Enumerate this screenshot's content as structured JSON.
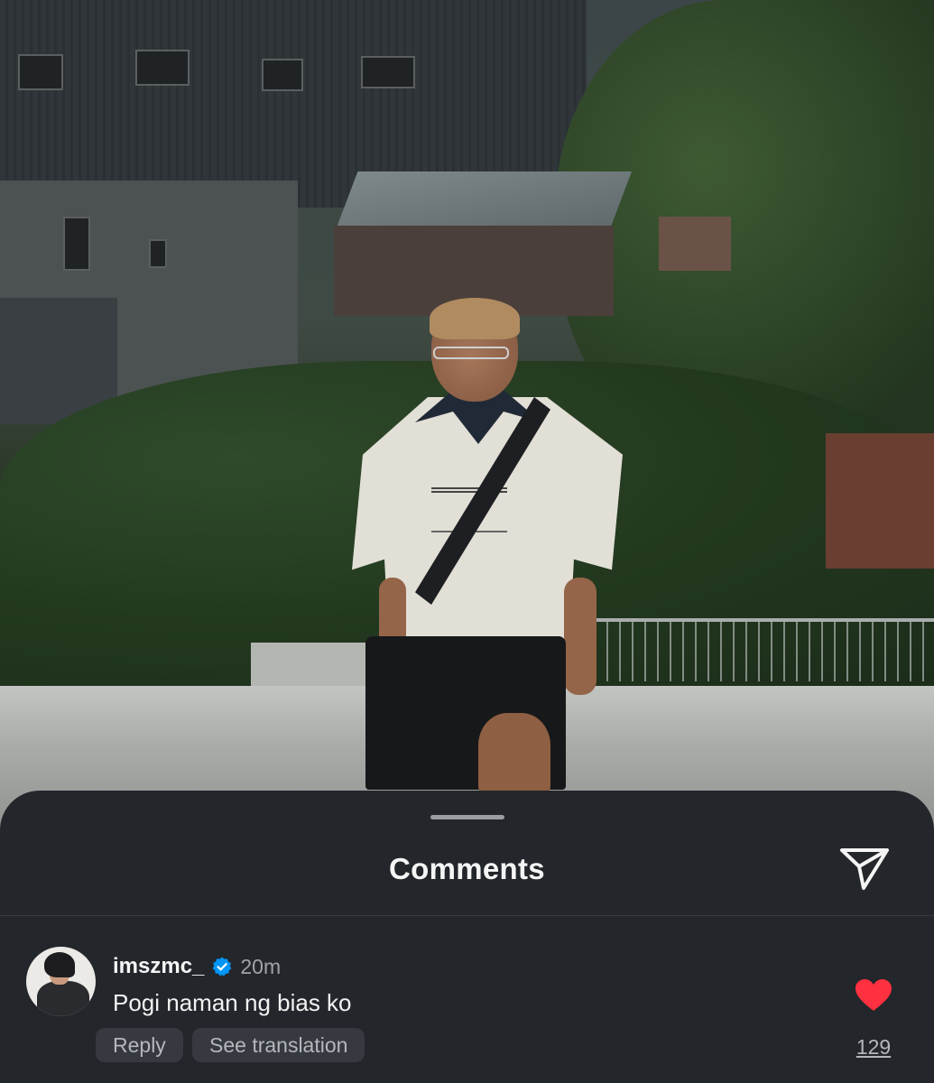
{
  "sheet": {
    "title": "Comments",
    "share_icon": "paper-plane-icon"
  },
  "comment": {
    "username": "imszmc_",
    "verified": true,
    "verified_icon": "verified-badge-icon",
    "time": "20m",
    "text": "Pogi naman ng bias ko",
    "reply_label": "Reply",
    "translate_label": "See translation",
    "liked": true,
    "like_icon": "heart-filled-icon",
    "like_count": "129"
  },
  "colors": {
    "sheet_background": "#23262b",
    "like_red": "#ff3040",
    "verified_blue": "#0095f6",
    "secondary_text": "#a0a3a8"
  }
}
